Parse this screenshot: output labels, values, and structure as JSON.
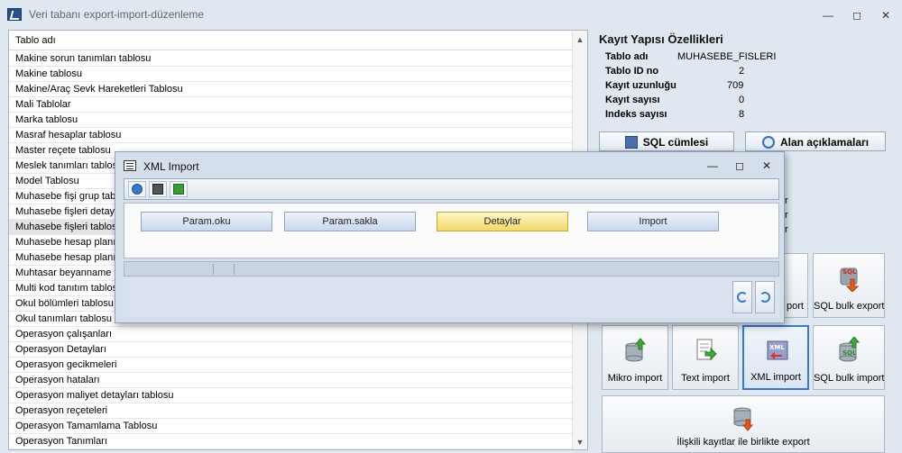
{
  "window": {
    "title": "Veri tabanı export-import-düzenleme",
    "minimize": "—",
    "restore": "◻",
    "close": "✕"
  },
  "table_list": {
    "header": "Tablo adı",
    "items": [
      "Makine sorun tanımları tablosu",
      "Makine tablosu",
      "Makine/Araç Sevk Hareketleri Tablosu",
      "Mali Tablolar",
      "Marka tablosu",
      "Masraf hesaplar tablosu",
      "Master reçete tablosu",
      "Meslek tanımları tablosu",
      "Model Tablosu",
      "Muhasebe fişi grup tablosu",
      "Muhasebe fişleri detay tablosu",
      "Muhasebe fişleri tablosu",
      "Muhasebe hesap planı",
      "Muhasebe hesap planı detayları",
      "Muhtasar beyanname tablosu",
      "Multi kod tanıtım tablosu",
      "Okul bölümleri tablosu",
      "Okul tanımları tablosu",
      "Operasyon çalışanları",
      "Operasyon Detayları",
      "Operasyon gecikmeleri",
      "Operasyon hataları",
      "Operasyon maliyet detayları tablosu",
      "Operasyon reçeteleri",
      "Operasyon Tamamlama Tablosu",
      "Operasyon Tanımları"
    ],
    "selected_index": 11
  },
  "properties": {
    "title": "Kayıt Yapısı Özellikleri",
    "rows": [
      {
        "label": "Tablo adı",
        "value": "MUHASEBE_FISLERI"
      },
      {
        "label": "Tablo ID no",
        "value": "2"
      },
      {
        "label": "Kayıt uzunluğu",
        "value": "709"
      },
      {
        "label": "Kayıt sayısı",
        "value": "0"
      },
      {
        "label": "Indeks sayısı",
        "value": "8"
      }
    ],
    "sql_button": "SQL cümlesi",
    "fields_button": "Alan açıklamaları",
    "partial_r1": "r",
    "partial_r2": "r",
    "partial_r3": "r"
  },
  "tiles": {
    "export_partial": "port",
    "sql_bulk_export": "SQL bulk export",
    "mikro_import": "Mikro import",
    "text_import": "Text import",
    "xml_import": "XML import",
    "sql_bulk_import": "SQL bulk import",
    "related_export": "İlişkili kayıtlar ile birlikte export"
  },
  "dialog": {
    "title": "XML Import",
    "buttons": [
      "Param.oku",
      "Param.sakla",
      "Detaylar",
      "Import"
    ],
    "highlighted": 2
  }
}
